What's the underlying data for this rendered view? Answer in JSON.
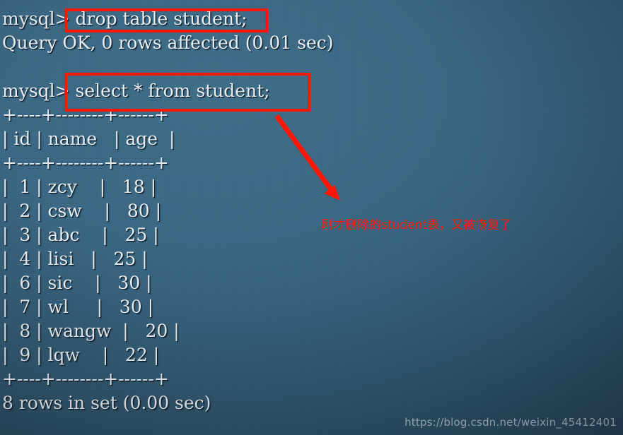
{
  "background": {
    "base_color": "#39637d",
    "edge_color": "#223e52",
    "highlight_color": "#3d6b85"
  },
  "terminal": {
    "prompt": "mysql>",
    "text_color": "#e8eef2",
    "lines": [
      {
        "id": "line-drop-cmd",
        "text": "mysql> drop table student;"
      },
      {
        "id": "line-drop-result",
        "text": "Query OK, 0 rows affected (0.01 sec)"
      },
      {
        "id": "line-blank-1",
        "text": ""
      },
      {
        "id": "line-select-cmd",
        "text": "mysql> select * from student;"
      },
      {
        "id": "line-sep-top",
        "text": "+----+--------+------+"
      },
      {
        "id": "line-header",
        "text": "| id | name   | age  |"
      },
      {
        "id": "line-sep-mid",
        "text": "+----+--------+------+"
      },
      {
        "id": "line-row-1",
        "text": "|  1 | zcy    |   18 |"
      },
      {
        "id": "line-row-2",
        "text": "|  2 | csw    |   80 |"
      },
      {
        "id": "line-row-3",
        "text": "|  3 | abc    |   25 |"
      },
      {
        "id": "line-row-4",
        "text": "|  4 | lisi   |   25 |"
      },
      {
        "id": "line-row-6",
        "text": "|  6 | sic    |   30 |"
      },
      {
        "id": "line-row-7",
        "text": "|  7 | wl     |   30 |"
      },
      {
        "id": "line-row-8",
        "text": "|  8 | wangw  |   20 |"
      },
      {
        "id": "line-row-9",
        "text": "|  9 | lqw    |   22 |"
      },
      {
        "id": "line-sep-bot",
        "text": "+----+--------+------+"
      },
      {
        "id": "line-rowcount",
        "text": "8 rows in set (0.00 sec)"
      }
    ],
    "commands": {
      "drop_statement": "drop table student;",
      "select_statement": "select * from student;"
    },
    "drop_result": "Query OK, 0 rows affected (0.01 sec)",
    "row_count_status": "8 rows in set (0.00 sec)",
    "result_table": {
      "columns": [
        "id",
        "name",
        "age"
      ],
      "rows": [
        [
          "1",
          "zcy",
          "18"
        ],
        [
          "2",
          "csw",
          "80"
        ],
        [
          "3",
          "abc",
          "25"
        ],
        [
          "4",
          "lisi",
          "25"
        ],
        [
          "6",
          "sic",
          "30"
        ],
        [
          "7",
          "wl",
          "30"
        ],
        [
          "8",
          "wangw",
          "20"
        ],
        [
          "9",
          "lqw",
          "22"
        ]
      ],
      "row_count": 8,
      "elapsed": "0.00 sec"
    }
  },
  "annotations": {
    "color": "#ff1a08",
    "note_text": "刚才删除的student表，又被恢复了",
    "highlight_boxes": [
      {
        "name": "drop-table-highlight",
        "target": "drop table student;"
      },
      {
        "name": "select-query-highlight",
        "target": "select * from student;"
      }
    ],
    "arrow": {
      "name": "pointer-arrow",
      "from": "select * from student;",
      "to": "刚才删除的student表，又被恢复了"
    }
  },
  "watermark": {
    "url": "https://blog.csdn.net/weixin_45412401"
  }
}
